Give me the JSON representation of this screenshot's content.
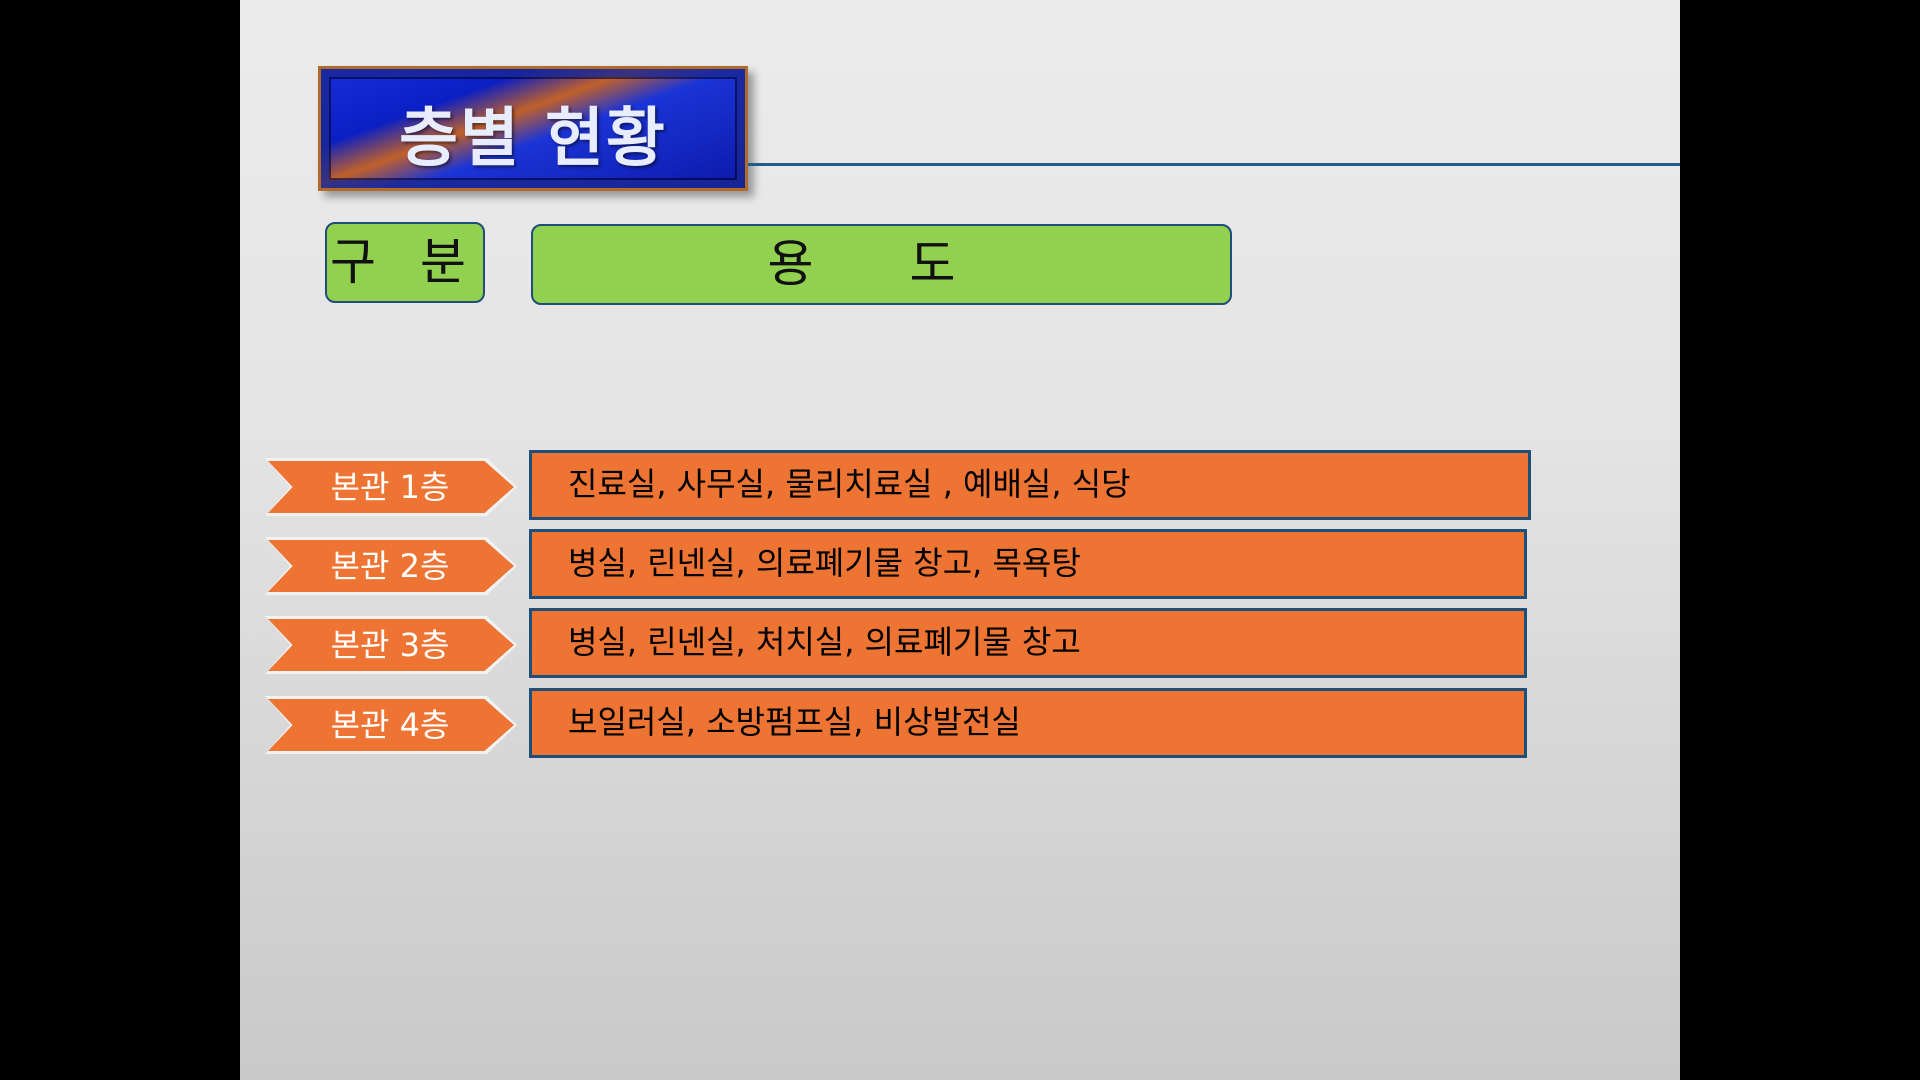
{
  "title": "층별 현황",
  "headers": {
    "category": "구 분",
    "usage": "용 도"
  },
  "rows": [
    {
      "floor": "본관 1층",
      "usage": "진료실,  사무실, 물리치료실 , 예배실, 식당"
    },
    {
      "floor": "본관 2층",
      "usage": "병실, 린넨실, 의료폐기물 창고, 목욕탕"
    },
    {
      "floor": "본관 3층",
      "usage": "병실, 린넨실, 처치실, 의료폐기물 창고"
    },
    {
      "floor": "본관 4층",
      "usage": "보일러실, 소방펌프실, 비상발전실"
    }
  ],
  "colors": {
    "header_fill": "#92d050",
    "row_fill": "#ed7432",
    "border": "#1f4e79",
    "title_fill": "#0a1fc4"
  }
}
